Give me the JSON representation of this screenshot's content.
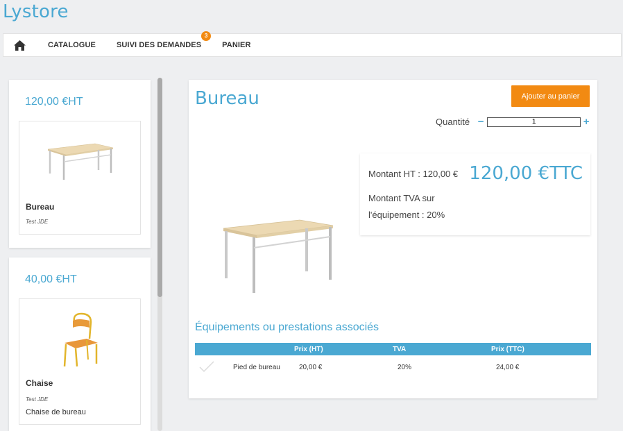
{
  "app": {
    "title": "Lystore"
  },
  "nav": {
    "home_icon": "home-icon",
    "items": [
      {
        "label": "CATALOGUE"
      },
      {
        "label": "SUIVI DES DEMANDES",
        "badge": "3"
      },
      {
        "label": "PANIER"
      }
    ]
  },
  "products": [
    {
      "price": "120,00 €HT",
      "name": "Bureau",
      "supplier": "Test JDE",
      "description": "",
      "icon": "desk-image"
    },
    {
      "price": "40,00 €HT",
      "name": "Chaise",
      "supplier": "Test JDE",
      "description": "Chaise de bureau",
      "icon": "chair-image"
    }
  ],
  "detail": {
    "title": "Bureau",
    "add_to_cart": "Ajouter au panier",
    "quantity_label": "Quantité",
    "quantity_value": "1",
    "minus": "−",
    "plus": "+",
    "amount_ht": "Montant HT : 120,00 €",
    "amount_ttc": "120,00 €TTC",
    "tva_text": "Montant TVA sur l'équipement : 20%",
    "associated_title": "Équipements ou prestations associés",
    "table": {
      "headers": [
        "",
        "",
        "Prix (HT)",
        "TVA",
        "Prix (TTC)"
      ],
      "rows": [
        {
          "name": "Pied de bureau",
          "price_ht": "20,00 €",
          "tva": "20%",
          "price_ttc": "24,00 €"
        }
      ]
    }
  },
  "colors": {
    "accent": "#4aa8d2",
    "orange": "#f28a12",
    "background": "#eeeff1"
  }
}
